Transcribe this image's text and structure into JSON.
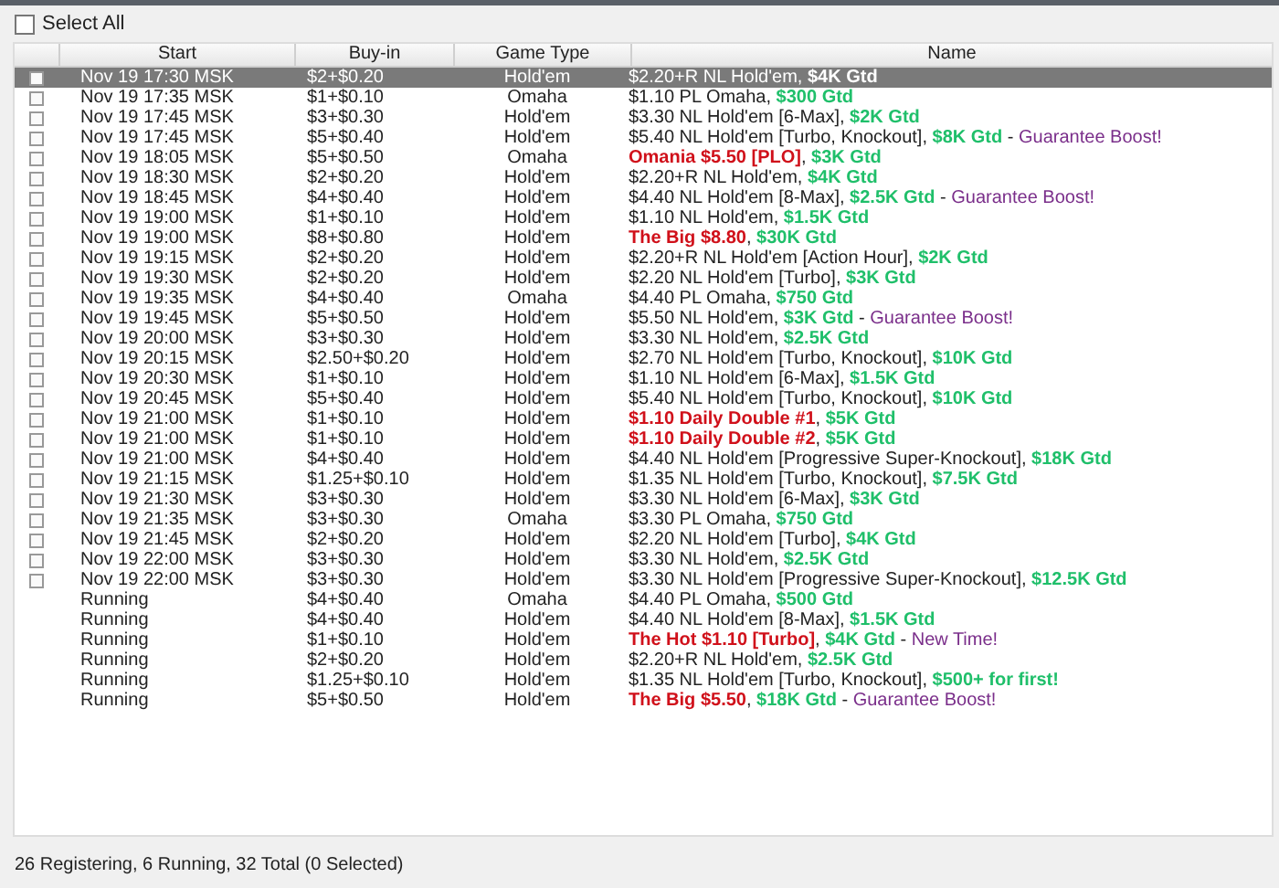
{
  "select_all": {
    "label": "Select All",
    "checked": false
  },
  "table": {
    "columns": [
      "Start",
      "Buy-in",
      "Game Type",
      "Name"
    ],
    "rows": [
      {
        "kind": "registering",
        "checked": false,
        "selected": true,
        "start": "Nov 19 17:30 MSK",
        "buyin": "$2+$0.20",
        "game_type": "Hold'em",
        "name": [
          {
            "kind": "plain",
            "text": "$2.20+R NL Hold'em, "
          },
          {
            "kind": "gtd",
            "text": "$4K Gtd"
          }
        ]
      },
      {
        "kind": "registering",
        "checked": false,
        "selected": false,
        "start": "Nov 19 17:35 MSK",
        "buyin": "$1+$0.10",
        "game_type": "Omaha",
        "name": [
          {
            "kind": "plain",
            "text": "$1.10 PL Omaha, "
          },
          {
            "kind": "gtd",
            "text": "$300 Gtd"
          }
        ]
      },
      {
        "kind": "registering",
        "checked": false,
        "selected": false,
        "start": "Nov 19 17:45 MSK",
        "buyin": "$3+$0.30",
        "game_type": "Hold'em",
        "name": [
          {
            "kind": "plain",
            "text": "$3.30 NL Hold'em [6-Max], "
          },
          {
            "kind": "gtd",
            "text": "$2K Gtd"
          }
        ]
      },
      {
        "kind": "registering",
        "checked": false,
        "selected": false,
        "start": "Nov 19 17:45 MSK",
        "buyin": "$5+$0.40",
        "game_type": "Hold'em",
        "name": [
          {
            "kind": "plain",
            "text": "$5.40 NL Hold'em [Turbo, Knockout], "
          },
          {
            "kind": "gtd",
            "text": "$8K Gtd"
          },
          {
            "kind": "plain",
            "text": " - "
          },
          {
            "kind": "promo",
            "text": "Guarantee Boost!"
          }
        ]
      },
      {
        "kind": "registering",
        "checked": false,
        "selected": false,
        "start": "Nov 19 18:05 MSK",
        "buyin": "$5+$0.50",
        "game_type": "Omaha",
        "name": [
          {
            "kind": "featured",
            "text": "Omania $5.50 [PLO]"
          },
          {
            "kind": "plain",
            "text": ", "
          },
          {
            "kind": "gtd",
            "text": "$3K Gtd"
          }
        ]
      },
      {
        "kind": "registering",
        "checked": false,
        "selected": false,
        "start": "Nov 19 18:30 MSK",
        "buyin": "$2+$0.20",
        "game_type": "Hold'em",
        "name": [
          {
            "kind": "plain",
            "text": "$2.20+R NL Hold'em, "
          },
          {
            "kind": "gtd",
            "text": "$4K Gtd"
          }
        ]
      },
      {
        "kind": "registering",
        "checked": false,
        "selected": false,
        "start": "Nov 19 18:45 MSK",
        "buyin": "$4+$0.40",
        "game_type": "Hold'em",
        "name": [
          {
            "kind": "plain",
            "text": "$4.40 NL Hold'em [8-Max], "
          },
          {
            "kind": "gtd",
            "text": "$2.5K Gtd"
          },
          {
            "kind": "plain",
            "text": " - "
          },
          {
            "kind": "promo",
            "text": "Guarantee Boost!"
          }
        ]
      },
      {
        "kind": "registering",
        "checked": false,
        "selected": false,
        "start": "Nov 19 19:00 MSK",
        "buyin": "$1+$0.10",
        "game_type": "Hold'em",
        "name": [
          {
            "kind": "plain",
            "text": "$1.10 NL Hold'em, "
          },
          {
            "kind": "gtd",
            "text": "$1.5K Gtd"
          }
        ]
      },
      {
        "kind": "registering",
        "checked": false,
        "selected": false,
        "start": "Nov 19 19:00 MSK",
        "buyin": "$8+$0.80",
        "game_type": "Hold'em",
        "name": [
          {
            "kind": "featured",
            "text": "The Big $8.80"
          },
          {
            "kind": "plain",
            "text": ", "
          },
          {
            "kind": "gtd",
            "text": "$30K Gtd"
          }
        ]
      },
      {
        "kind": "registering",
        "checked": false,
        "selected": false,
        "start": "Nov 19 19:15 MSK",
        "buyin": "$2+$0.20",
        "game_type": "Hold'em",
        "name": [
          {
            "kind": "plain",
            "text": "$2.20+R NL Hold'em [Action Hour], "
          },
          {
            "kind": "gtd",
            "text": "$2K Gtd"
          }
        ]
      },
      {
        "kind": "registering",
        "checked": false,
        "selected": false,
        "start": "Nov 19 19:30 MSK",
        "buyin": "$2+$0.20",
        "game_type": "Hold'em",
        "name": [
          {
            "kind": "plain",
            "text": "$2.20 NL Hold'em [Turbo], "
          },
          {
            "kind": "gtd",
            "text": "$3K Gtd"
          }
        ]
      },
      {
        "kind": "registering",
        "checked": false,
        "selected": false,
        "start": "Nov 19 19:35 MSK",
        "buyin": "$4+$0.40",
        "game_type": "Omaha",
        "name": [
          {
            "kind": "plain",
            "text": "$4.40 PL Omaha, "
          },
          {
            "kind": "gtd",
            "text": "$750 Gtd"
          }
        ]
      },
      {
        "kind": "registering",
        "checked": false,
        "selected": false,
        "start": "Nov 19 19:45 MSK",
        "buyin": "$5+$0.50",
        "game_type": "Hold'em",
        "name": [
          {
            "kind": "plain",
            "text": "$5.50 NL Hold'em, "
          },
          {
            "kind": "gtd",
            "text": "$3K Gtd"
          },
          {
            "kind": "plain",
            "text": " - "
          },
          {
            "kind": "promo",
            "text": "Guarantee Boost!"
          }
        ]
      },
      {
        "kind": "registering",
        "checked": false,
        "selected": false,
        "start": "Nov 19 20:00 MSK",
        "buyin": "$3+$0.30",
        "game_type": "Hold'em",
        "name": [
          {
            "kind": "plain",
            "text": "$3.30 NL Hold'em, "
          },
          {
            "kind": "gtd",
            "text": "$2.5K Gtd"
          }
        ]
      },
      {
        "kind": "registering",
        "checked": false,
        "selected": false,
        "start": "Nov 19 20:15 MSK",
        "buyin": "$2.50+$0.20",
        "game_type": "Hold'em",
        "name": [
          {
            "kind": "plain",
            "text": "$2.70 NL Hold'em [Turbo, Knockout], "
          },
          {
            "kind": "gtd",
            "text": "$10K Gtd"
          }
        ]
      },
      {
        "kind": "registering",
        "checked": false,
        "selected": false,
        "start": "Nov 19 20:30 MSK",
        "buyin": "$1+$0.10",
        "game_type": "Hold'em",
        "name": [
          {
            "kind": "plain",
            "text": "$1.10 NL Hold'em [6-Max], "
          },
          {
            "kind": "gtd",
            "text": "$1.5K Gtd"
          }
        ]
      },
      {
        "kind": "registering",
        "checked": false,
        "selected": false,
        "start": "Nov 19 20:45 MSK",
        "buyin": "$5+$0.40",
        "game_type": "Hold'em",
        "name": [
          {
            "kind": "plain",
            "text": "$5.40 NL Hold'em [Turbo, Knockout], "
          },
          {
            "kind": "gtd",
            "text": "$10K Gtd"
          }
        ]
      },
      {
        "kind": "registering",
        "checked": false,
        "selected": false,
        "start": "Nov 19 21:00 MSK",
        "buyin": "$1+$0.10",
        "game_type": "Hold'em",
        "name": [
          {
            "kind": "featured",
            "text": "$1.10 Daily Double #1"
          },
          {
            "kind": "plain",
            "text": ", "
          },
          {
            "kind": "gtd",
            "text": "$5K Gtd"
          }
        ]
      },
      {
        "kind": "registering",
        "checked": false,
        "selected": false,
        "start": "Nov 19 21:00 MSK",
        "buyin": "$1+$0.10",
        "game_type": "Hold'em",
        "name": [
          {
            "kind": "featured",
            "text": "$1.10 Daily Double #2"
          },
          {
            "kind": "plain",
            "text": ", "
          },
          {
            "kind": "gtd",
            "text": "$5K Gtd"
          }
        ]
      },
      {
        "kind": "registering",
        "checked": false,
        "selected": false,
        "start": "Nov 19 21:00 MSK",
        "buyin": "$4+$0.40",
        "game_type": "Hold'em",
        "name": [
          {
            "kind": "plain",
            "text": "$4.40 NL Hold'em [Progressive Super-Knockout], "
          },
          {
            "kind": "gtd",
            "text": "$18K Gtd"
          }
        ]
      },
      {
        "kind": "registering",
        "checked": false,
        "selected": false,
        "start": "Nov 19 21:15 MSK",
        "buyin": "$1.25+$0.10",
        "game_type": "Hold'em",
        "name": [
          {
            "kind": "plain",
            "text": "$1.35 NL Hold'em [Turbo, Knockout], "
          },
          {
            "kind": "gtd",
            "text": "$7.5K Gtd"
          }
        ]
      },
      {
        "kind": "registering",
        "checked": false,
        "selected": false,
        "start": "Nov 19 21:30 MSK",
        "buyin": "$3+$0.30",
        "game_type": "Hold'em",
        "name": [
          {
            "kind": "plain",
            "text": "$3.30 NL Hold'em [6-Max], "
          },
          {
            "kind": "gtd",
            "text": "$3K Gtd"
          }
        ]
      },
      {
        "kind": "registering",
        "checked": false,
        "selected": false,
        "start": "Nov 19 21:35 MSK",
        "buyin": "$3+$0.30",
        "game_type": "Omaha",
        "name": [
          {
            "kind": "plain",
            "text": "$3.30 PL Omaha, "
          },
          {
            "kind": "gtd",
            "text": "$750 Gtd"
          }
        ]
      },
      {
        "kind": "registering",
        "checked": false,
        "selected": false,
        "start": "Nov 19 21:45 MSK",
        "buyin": "$2+$0.20",
        "game_type": "Hold'em",
        "name": [
          {
            "kind": "plain",
            "text": "$2.20 NL Hold'em [Turbo], "
          },
          {
            "kind": "gtd",
            "text": "$4K Gtd"
          }
        ]
      },
      {
        "kind": "registering",
        "checked": false,
        "selected": false,
        "start": "Nov 19 22:00 MSK",
        "buyin": "$3+$0.30",
        "game_type": "Hold'em",
        "name": [
          {
            "kind": "plain",
            "text": "$3.30 NL Hold'em, "
          },
          {
            "kind": "gtd",
            "text": "$2.5K Gtd"
          }
        ]
      },
      {
        "kind": "registering",
        "checked": false,
        "selected": false,
        "start": "Nov 19 22:00 MSK",
        "buyin": "$3+$0.30",
        "game_type": "Hold'em",
        "name": [
          {
            "kind": "plain",
            "text": "$3.30 NL Hold'em [Progressive Super-Knockout], "
          },
          {
            "kind": "gtd",
            "text": "$12.5K Gtd"
          }
        ]
      },
      {
        "kind": "running",
        "selected": false,
        "start": "Running",
        "buyin": "$4+$0.40",
        "game_type": "Omaha",
        "name": [
          {
            "kind": "plain",
            "text": "$4.40 PL Omaha, "
          },
          {
            "kind": "gtd",
            "text": "$500 Gtd"
          }
        ]
      },
      {
        "kind": "running",
        "selected": false,
        "start": "Running",
        "buyin": "$4+$0.40",
        "game_type": "Hold'em",
        "name": [
          {
            "kind": "plain",
            "text": "$4.40 NL Hold'em [8-Max], "
          },
          {
            "kind": "gtd",
            "text": "$1.5K Gtd"
          }
        ]
      },
      {
        "kind": "running",
        "selected": false,
        "start": "Running",
        "buyin": "$1+$0.10",
        "game_type": "Hold'em",
        "name": [
          {
            "kind": "featured",
            "text": "The Hot $1.10 [Turbo]"
          },
          {
            "kind": "plain",
            "text": ", "
          },
          {
            "kind": "gtd",
            "text": "$4K Gtd"
          },
          {
            "kind": "plain",
            "text": " - "
          },
          {
            "kind": "promo",
            "text": "New Time!"
          }
        ]
      },
      {
        "kind": "running",
        "selected": false,
        "start": "Running",
        "buyin": "$2+$0.20",
        "game_type": "Hold'em",
        "name": [
          {
            "kind": "plain",
            "text": "$2.20+R NL Hold'em, "
          },
          {
            "kind": "gtd",
            "text": "$2.5K Gtd"
          }
        ]
      },
      {
        "kind": "running",
        "selected": false,
        "start": "Running",
        "buyin": "$1.25+$0.10",
        "game_type": "Hold'em",
        "name": [
          {
            "kind": "plain",
            "text": "$1.35 NL Hold'em [Turbo, Knockout], "
          },
          {
            "kind": "gtd",
            "text": "$500+ for first!"
          }
        ]
      },
      {
        "kind": "running",
        "selected": false,
        "start": "Running",
        "buyin": "$5+$0.50",
        "game_type": "Hold'em",
        "name": [
          {
            "kind": "featured",
            "text": "The Big $5.50"
          },
          {
            "kind": "plain",
            "text": ", "
          },
          {
            "kind": "gtd",
            "text": "$18K Gtd"
          },
          {
            "kind": "plain",
            "text": " - "
          },
          {
            "kind": "promo",
            "text": "Guarantee Boost!"
          }
        ]
      }
    ]
  },
  "status_bar": "26 Registering, 6 Running, 32 Total (0 Selected)"
}
